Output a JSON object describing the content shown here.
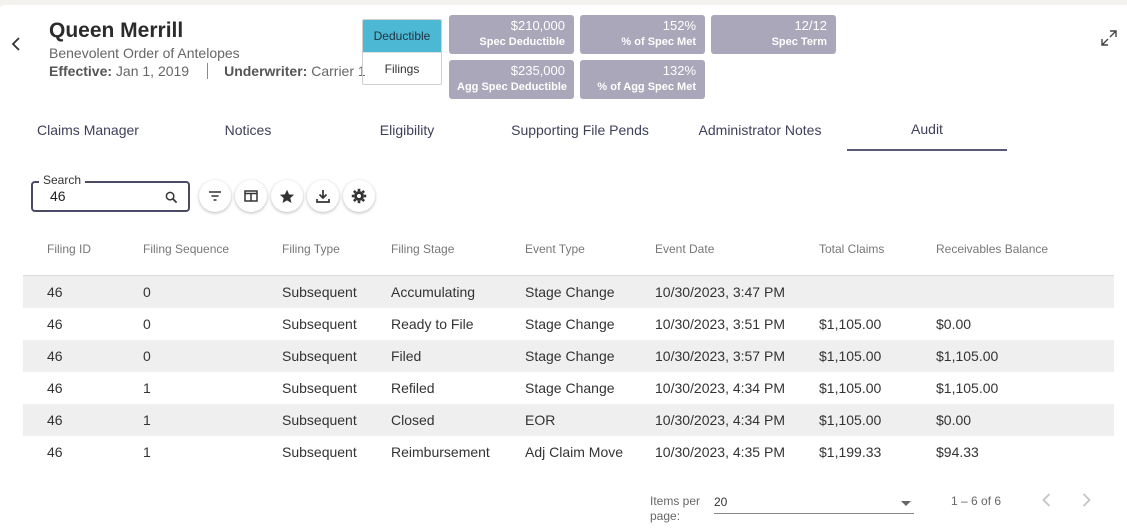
{
  "header": {
    "name": "Queen Merrill",
    "organization": "Benevolent Order of Antelopes",
    "effective_label": "Effective:",
    "effective_value": "Jan 1, 2019",
    "underwriter_label": "Underwriter:",
    "underwriter_value": "Carrier 1"
  },
  "view_toggle": {
    "options": [
      "Deductible",
      "Filings"
    ],
    "selected": "Deductible",
    "active_color": "#4db8d3"
  },
  "kpis": [
    {
      "value": "$210,000",
      "label": "Spec Deductible"
    },
    {
      "value": "152%",
      "label": "% of Spec Met"
    },
    {
      "value": "12/12",
      "label": "Spec Term"
    },
    {
      "value": "$235,000",
      "label": "Agg Spec Deductible"
    },
    {
      "value": "132%",
      "label": "% of Agg Spec Met"
    }
  ],
  "kpi_color": "#a9a7b9",
  "tabs": [
    {
      "label": "Claims Manager"
    },
    {
      "label": "Notices"
    },
    {
      "label": "Eligibility"
    },
    {
      "label": "Supporting File Pends"
    },
    {
      "label": "Administrator Notes"
    },
    {
      "label": "Audit"
    }
  ],
  "active_tab": "Audit",
  "search": {
    "label": "Search",
    "value": "46",
    "icon": "search-icon"
  },
  "toolbar_icons": [
    "filter-icon",
    "columns-icon",
    "star-icon",
    "download-icon",
    "settings-gear-icon"
  ],
  "table": {
    "columns": [
      "Filing ID",
      "Filing Sequence",
      "Filing Type",
      "Filing Stage",
      "Event Type",
      "Event Date",
      "Total Claims",
      "Receivables Balance"
    ],
    "rows": [
      [
        "46",
        "0",
        "Subsequent",
        "Accumulating",
        "Stage Change",
        "10/30/2023, 3:47 PM",
        "",
        ""
      ],
      [
        "46",
        "0",
        "Subsequent",
        "Ready to File",
        "Stage Change",
        "10/30/2023, 3:51 PM",
        "$1,105.00",
        "$0.00"
      ],
      [
        "46",
        "0",
        "Subsequent",
        "Filed",
        "Stage Change",
        "10/30/2023, 3:57 PM",
        "$1,105.00",
        "$1,105.00"
      ],
      [
        "46",
        "1",
        "Subsequent",
        "Refiled",
        "Stage Change",
        "10/30/2023, 4:34 PM",
        "$1,105.00",
        "$1,105.00"
      ],
      [
        "46",
        "1",
        "Subsequent",
        "Closed",
        "EOR",
        "10/30/2023, 4:34 PM",
        "$1,105.00",
        "$0.00"
      ],
      [
        "46",
        "1",
        "Subsequent",
        "Reimbursement",
        "Adj Claim Move",
        "10/30/2023, 4:35 PM",
        "$1,199.33",
        "$94.33"
      ]
    ]
  },
  "pagination": {
    "items_per_page_label": "Items per page:",
    "items_per_page_value": "20",
    "range": "1 – 6 of 6"
  }
}
